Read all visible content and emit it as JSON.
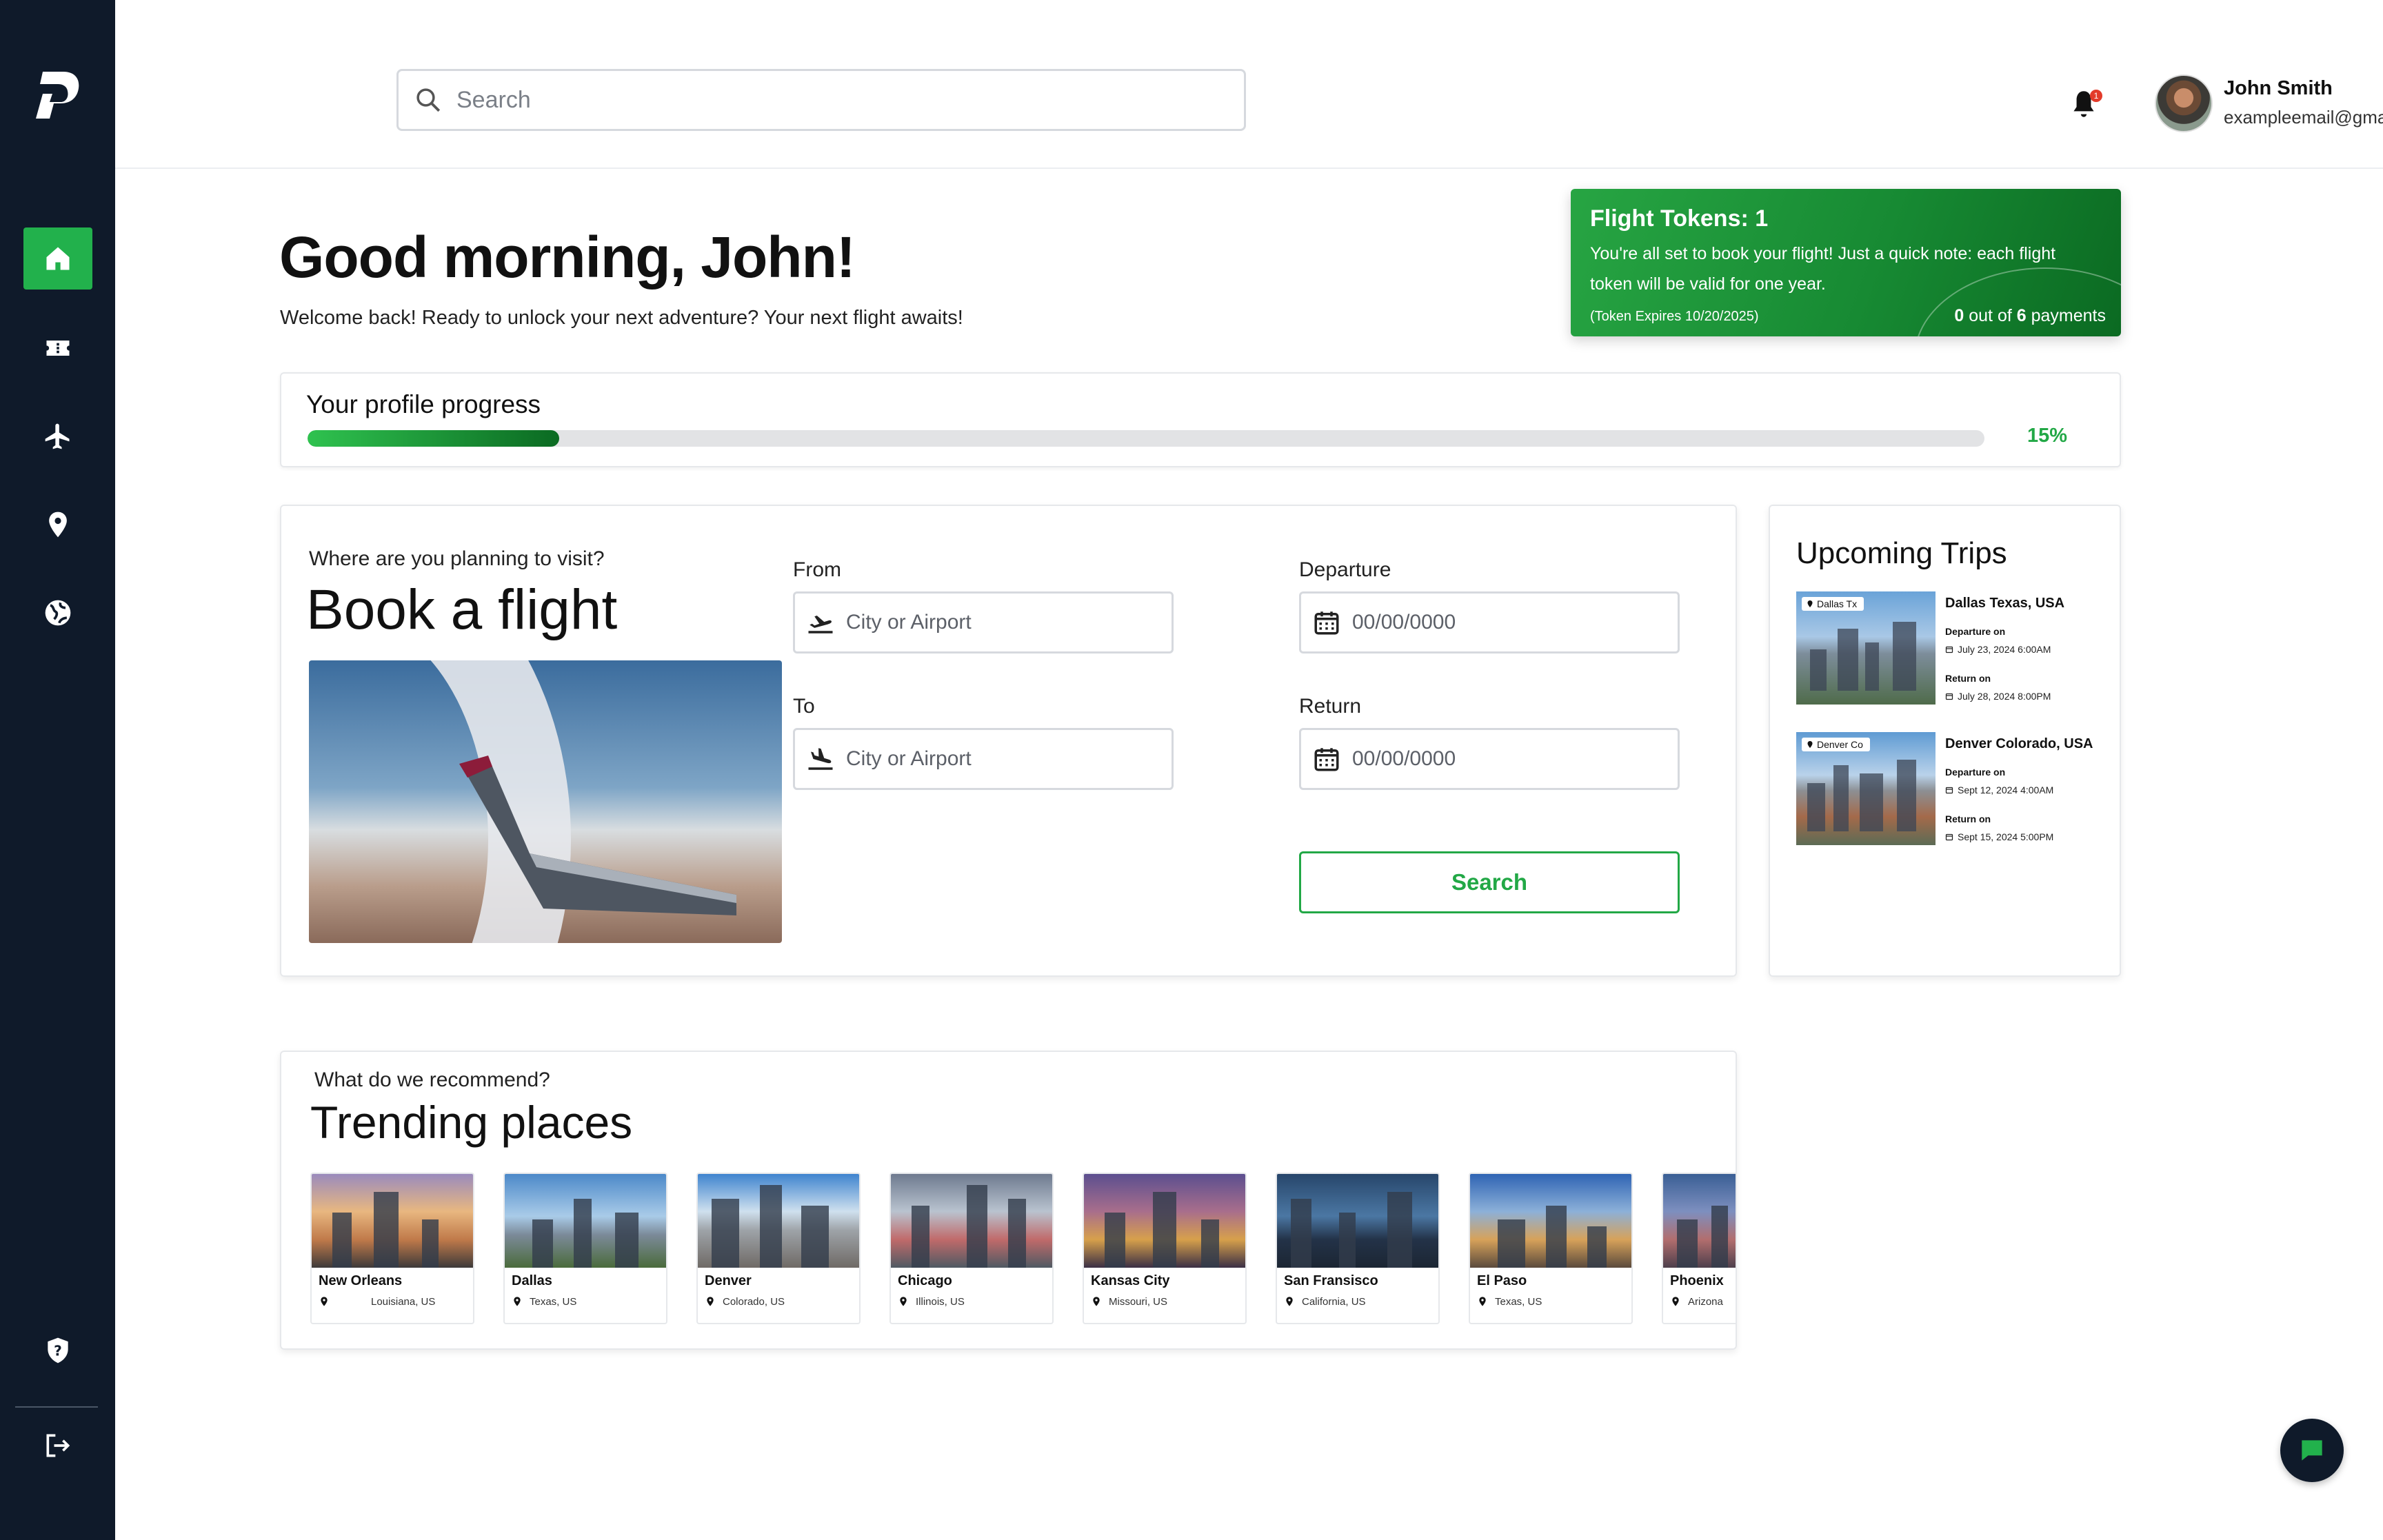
{
  "colors": {
    "sidebar_bg": "#0f1a2a",
    "accent_green": "#22a846",
    "active_nav": "#22b14c",
    "notification_badge": "#e33b2a"
  },
  "sidebar": {
    "logo_icon": "brand-logo-icon",
    "items": [
      {
        "icon": "home-icon",
        "active": true
      },
      {
        "icon": "ticket-icon",
        "active": false
      },
      {
        "icon": "airplane-icon",
        "active": false
      },
      {
        "icon": "location-pin-icon",
        "active": false
      },
      {
        "icon": "globe-icon",
        "active": false
      }
    ],
    "bottom_items": [
      {
        "icon": "shield-help-icon"
      },
      {
        "icon": "logout-icon"
      }
    ]
  },
  "header": {
    "search_placeholder": "Search",
    "notification_count": "1",
    "user": {
      "name": "John Smith",
      "email": "exampleemail@gmail.com"
    }
  },
  "greeting": {
    "title": "Good morning, John!",
    "subtitle": "Welcome back! Ready to unlock your next adventure? Your next flight awaits!"
  },
  "token_card": {
    "title": "Flight Tokens:  1",
    "description": "You're all set to book your flight! Just a quick note: each flight token will be valid for one year.",
    "expiry": "(Token Expires 10/20/2025)",
    "payments_done": "0",
    "payments_of": " out of ",
    "payments_total": "6",
    "payments_suffix": " payments"
  },
  "profile_progress": {
    "label": "Your profile progress",
    "value": 0.15,
    "percent_text": "15%"
  },
  "book_flight": {
    "subtitle": "Where are you planning to visit?",
    "title": "Book a flight",
    "from_label": "From",
    "from_placeholder": "City or Airport",
    "to_label": "To",
    "to_placeholder": "City or Airport",
    "departure_label": "Departure",
    "departure_placeholder": "00/00/0000",
    "return_label": "Return",
    "return_placeholder": "00/00/0000",
    "search_button": "Search"
  },
  "upcoming_trips": {
    "title": "Upcoming Trips",
    "trips": [
      {
        "tag": "Dallas Tx",
        "city": "Dallas Texas, USA",
        "departure_label": "Departure on",
        "departure_date": "July 23, 2024   6:00AM",
        "return_label": "Return on",
        "return_date": "July 28, 2024   8:00PM"
      },
      {
        "tag": "Denver Co",
        "city": "Denver Colorado, USA",
        "departure_label": "Departure on",
        "departure_date": "Sept 12, 2024   4:00AM",
        "return_label": "Return on",
        "return_date": "Sept 15, 2024   5:00PM"
      }
    ]
  },
  "trending": {
    "subtitle": "What do we recommend?",
    "title": "Trending places",
    "places": [
      {
        "name": "New Orleans",
        "location": "Louisiana, US"
      },
      {
        "name": "Dallas",
        "location": "Texas, US"
      },
      {
        "name": "Denver",
        "location": "Colorado, US"
      },
      {
        "name": "Chicago",
        "location": "Illinois, US"
      },
      {
        "name": "Kansas City",
        "location": "Missouri, US"
      },
      {
        "name": "San Fransisco",
        "location": "California, US"
      },
      {
        "name": "El Paso",
        "location": "Texas, US"
      },
      {
        "name": "Phoenix",
        "location": "Arizona"
      }
    ]
  },
  "chat": {
    "icon": "chat-bubble-icon"
  }
}
